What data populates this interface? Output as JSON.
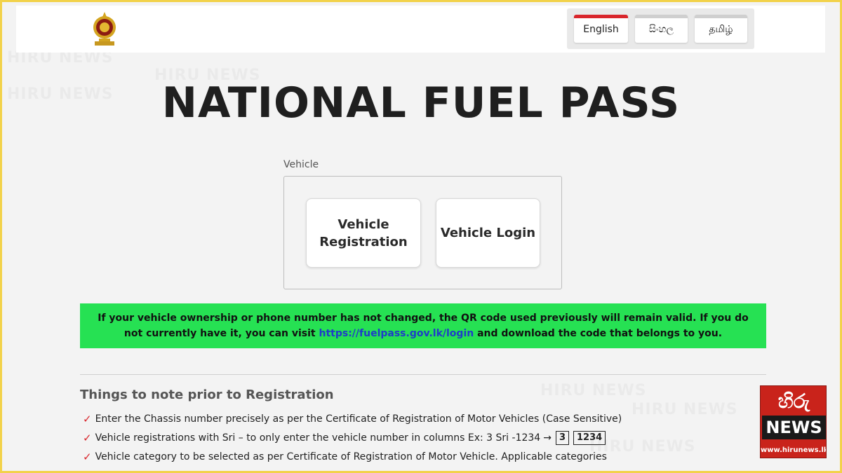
{
  "languages": [
    {
      "label": "English",
      "active": true
    },
    {
      "label": "සිංහල",
      "active": false
    },
    {
      "label": "தமிழ்",
      "active": false
    }
  ],
  "title": "NATIONAL FUEL PASS",
  "vehicle": {
    "label": "Vehicle",
    "registration_button": "Vehicle Registration",
    "login_button": "Vehicle Login"
  },
  "notice": {
    "text_before": "If your vehicle ownership or phone number has not changed, the QR code used previously will remain valid. If you do not currently have it, you can visit ",
    "link": "https://fuelpass.gov.lk/login",
    "text_after": " and download the code that belongs to you."
  },
  "notes": {
    "title": "Things to note prior to Registration",
    "items": [
      "Enter the Chassis number precisely as per the Certificate of Registration of Motor Vehicles (Case Sensitive)",
      "Vehicle registrations with Sri – to only enter the vehicle number in columns Ex: 3 Sri -1234",
      "Vehicle category to be selected as per Certificate of Registration of Motor Vehicle. Applicable categories"
    ],
    "example_arrow": "→",
    "example_box1": "3",
    "example_box2": "1234"
  },
  "watermark": {
    "logo_top": "හිරු",
    "logo_news": "NEWS",
    "logo_url": "www.hirunews.lk",
    "background_text": "HIRU NEWS"
  },
  "colors": {
    "notice_bg": "#26e153",
    "accent_red": "#d9262c",
    "frame": "#f2d24a"
  }
}
